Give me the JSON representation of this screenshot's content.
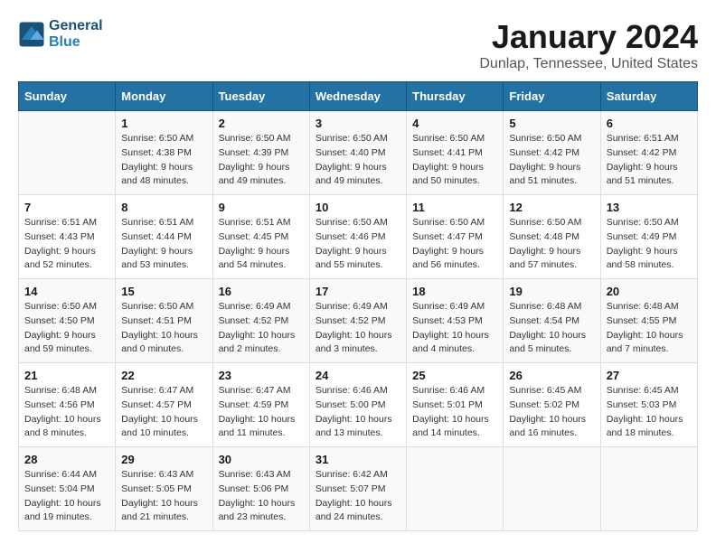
{
  "header": {
    "logo_general": "General",
    "logo_blue": "Blue",
    "title": "January 2024",
    "subtitle": "Dunlap, Tennessee, United States"
  },
  "days_of_week": [
    "Sunday",
    "Monday",
    "Tuesday",
    "Wednesday",
    "Thursday",
    "Friday",
    "Saturday"
  ],
  "weeks": [
    [
      {
        "day": "",
        "info": ""
      },
      {
        "day": "1",
        "info": "Sunrise: 6:50 AM\nSunset: 4:38 PM\nDaylight: 9 hours\nand 48 minutes."
      },
      {
        "day": "2",
        "info": "Sunrise: 6:50 AM\nSunset: 4:39 PM\nDaylight: 9 hours\nand 49 minutes."
      },
      {
        "day": "3",
        "info": "Sunrise: 6:50 AM\nSunset: 4:40 PM\nDaylight: 9 hours\nand 49 minutes."
      },
      {
        "day": "4",
        "info": "Sunrise: 6:50 AM\nSunset: 4:41 PM\nDaylight: 9 hours\nand 50 minutes."
      },
      {
        "day": "5",
        "info": "Sunrise: 6:50 AM\nSunset: 4:42 PM\nDaylight: 9 hours\nand 51 minutes."
      },
      {
        "day": "6",
        "info": "Sunrise: 6:51 AM\nSunset: 4:42 PM\nDaylight: 9 hours\nand 51 minutes."
      }
    ],
    [
      {
        "day": "7",
        "info": "Sunrise: 6:51 AM\nSunset: 4:43 PM\nDaylight: 9 hours\nand 52 minutes."
      },
      {
        "day": "8",
        "info": "Sunrise: 6:51 AM\nSunset: 4:44 PM\nDaylight: 9 hours\nand 53 minutes."
      },
      {
        "day": "9",
        "info": "Sunrise: 6:51 AM\nSunset: 4:45 PM\nDaylight: 9 hours\nand 54 minutes."
      },
      {
        "day": "10",
        "info": "Sunrise: 6:50 AM\nSunset: 4:46 PM\nDaylight: 9 hours\nand 55 minutes."
      },
      {
        "day": "11",
        "info": "Sunrise: 6:50 AM\nSunset: 4:47 PM\nDaylight: 9 hours\nand 56 minutes."
      },
      {
        "day": "12",
        "info": "Sunrise: 6:50 AM\nSunset: 4:48 PM\nDaylight: 9 hours\nand 57 minutes."
      },
      {
        "day": "13",
        "info": "Sunrise: 6:50 AM\nSunset: 4:49 PM\nDaylight: 9 hours\nand 58 minutes."
      }
    ],
    [
      {
        "day": "14",
        "info": "Sunrise: 6:50 AM\nSunset: 4:50 PM\nDaylight: 9 hours\nand 59 minutes."
      },
      {
        "day": "15",
        "info": "Sunrise: 6:50 AM\nSunset: 4:51 PM\nDaylight: 10 hours\nand 0 minutes."
      },
      {
        "day": "16",
        "info": "Sunrise: 6:49 AM\nSunset: 4:52 PM\nDaylight: 10 hours\nand 2 minutes."
      },
      {
        "day": "17",
        "info": "Sunrise: 6:49 AM\nSunset: 4:52 PM\nDaylight: 10 hours\nand 3 minutes."
      },
      {
        "day": "18",
        "info": "Sunrise: 6:49 AM\nSunset: 4:53 PM\nDaylight: 10 hours\nand 4 minutes."
      },
      {
        "day": "19",
        "info": "Sunrise: 6:48 AM\nSunset: 4:54 PM\nDaylight: 10 hours\nand 5 minutes."
      },
      {
        "day": "20",
        "info": "Sunrise: 6:48 AM\nSunset: 4:55 PM\nDaylight: 10 hours\nand 7 minutes."
      }
    ],
    [
      {
        "day": "21",
        "info": "Sunrise: 6:48 AM\nSunset: 4:56 PM\nDaylight: 10 hours\nand 8 minutes."
      },
      {
        "day": "22",
        "info": "Sunrise: 6:47 AM\nSunset: 4:57 PM\nDaylight: 10 hours\nand 10 minutes."
      },
      {
        "day": "23",
        "info": "Sunrise: 6:47 AM\nSunset: 4:59 PM\nDaylight: 10 hours\nand 11 minutes."
      },
      {
        "day": "24",
        "info": "Sunrise: 6:46 AM\nSunset: 5:00 PM\nDaylight: 10 hours\nand 13 minutes."
      },
      {
        "day": "25",
        "info": "Sunrise: 6:46 AM\nSunset: 5:01 PM\nDaylight: 10 hours\nand 14 minutes."
      },
      {
        "day": "26",
        "info": "Sunrise: 6:45 AM\nSunset: 5:02 PM\nDaylight: 10 hours\nand 16 minutes."
      },
      {
        "day": "27",
        "info": "Sunrise: 6:45 AM\nSunset: 5:03 PM\nDaylight: 10 hours\nand 18 minutes."
      }
    ],
    [
      {
        "day": "28",
        "info": "Sunrise: 6:44 AM\nSunset: 5:04 PM\nDaylight: 10 hours\nand 19 minutes."
      },
      {
        "day": "29",
        "info": "Sunrise: 6:43 AM\nSunset: 5:05 PM\nDaylight: 10 hours\nand 21 minutes."
      },
      {
        "day": "30",
        "info": "Sunrise: 6:43 AM\nSunset: 5:06 PM\nDaylight: 10 hours\nand 23 minutes."
      },
      {
        "day": "31",
        "info": "Sunrise: 6:42 AM\nSunset: 5:07 PM\nDaylight: 10 hours\nand 24 minutes."
      },
      {
        "day": "",
        "info": ""
      },
      {
        "day": "",
        "info": ""
      },
      {
        "day": "",
        "info": ""
      }
    ]
  ]
}
